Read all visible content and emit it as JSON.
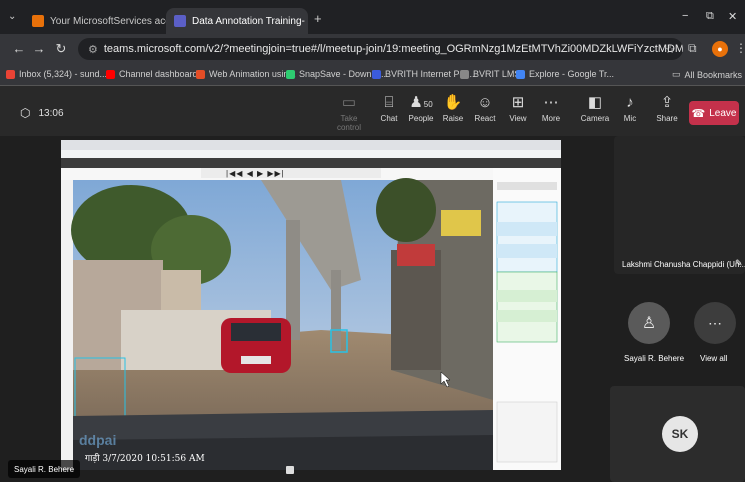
{
  "browser": {
    "tabs": [
      {
        "label": "Your MicrosoftServices account",
        "icon_color": "#e8710a"
      },
      {
        "label": "Data Annotation Training- Batc",
        "icon_color": "#5b5fc7"
      }
    ],
    "new_tab": "+",
    "window_controls": {
      "minimize": "−",
      "maximize": "⧉",
      "close": "✕"
    },
    "url": "teams.microsoft.com/v2/?meetingjoin=true#/l/meetup-join/19:meeting_OGRmNzg1MzEtMTVhZi00MDZkLWFiYzctMDM0OWUxYjUwMzk2@thread.v2/0...",
    "bookmarks": [
      {
        "label": "Inbox (5,324) - sund...",
        "icon_color": "#ea4335"
      },
      {
        "label": "Channel dashboard...",
        "icon_color": "#ff0000"
      },
      {
        "label": "Web Animation usin...",
        "icon_color": "#e44d26"
      },
      {
        "label": "SnapSave - Downlo...",
        "icon_color": "#2ecc71"
      },
      {
        "label": "BVRITH Internet Per...",
        "icon_color": "#3b5bdb"
      },
      {
        "label": "BVRIT LMS",
        "icon_color": "#888888"
      },
      {
        "label": "Explore - Google Tr...",
        "icon_color": "#4285f4"
      }
    ],
    "all_bookmarks": "All Bookmarks"
  },
  "meeting": {
    "timer": "13:06",
    "toolbar": [
      {
        "label": "Take control",
        "icon": "monitor-icon",
        "glyph": "▭",
        "disabled": true
      },
      {
        "label": "Chat",
        "icon": "chat-icon",
        "glyph": "⌸",
        "disabled": false
      },
      {
        "label": "People",
        "icon": "people-icon",
        "glyph": "♟",
        "count": "50",
        "disabled": false
      },
      {
        "label": "Raise",
        "icon": "raise-hand-icon",
        "glyph": "✋",
        "disabled": false
      },
      {
        "label": "React",
        "icon": "react-icon",
        "glyph": "☺",
        "disabled": false
      },
      {
        "label": "View",
        "icon": "view-icon",
        "glyph": "⊞",
        "disabled": false
      },
      {
        "label": "More",
        "icon": "more-icon",
        "glyph": "⋯",
        "disabled": false
      },
      {
        "label": "Camera",
        "icon": "camera-off-icon",
        "glyph": "◧",
        "disabled": false
      },
      {
        "label": "Mic",
        "icon": "mic-off-icon",
        "glyph": "♪",
        "disabled": false
      },
      {
        "label": "Share",
        "icon": "share-icon",
        "glyph": "⇪",
        "disabled": false
      }
    ],
    "leave_label": "Leave",
    "leave_color": "#c4314b",
    "presenter": "Sayali R. Behere",
    "participants": [
      {
        "name": "Lakshmi Chanusha Chappidi (Un...",
        "pinned_icon": "pin-icon"
      },
      {
        "name": "Sayali R. Behere"
      },
      {
        "name": "View all"
      },
      {
        "initials": "SK"
      }
    ]
  },
  "shared_screen": {
    "timestamp": "गाड़ी 3/7/2020  10:51:56 AM",
    "watermark": "ddpai",
    "player_controls": "|◀◀ ◀ ▶ ▶▶|"
  }
}
